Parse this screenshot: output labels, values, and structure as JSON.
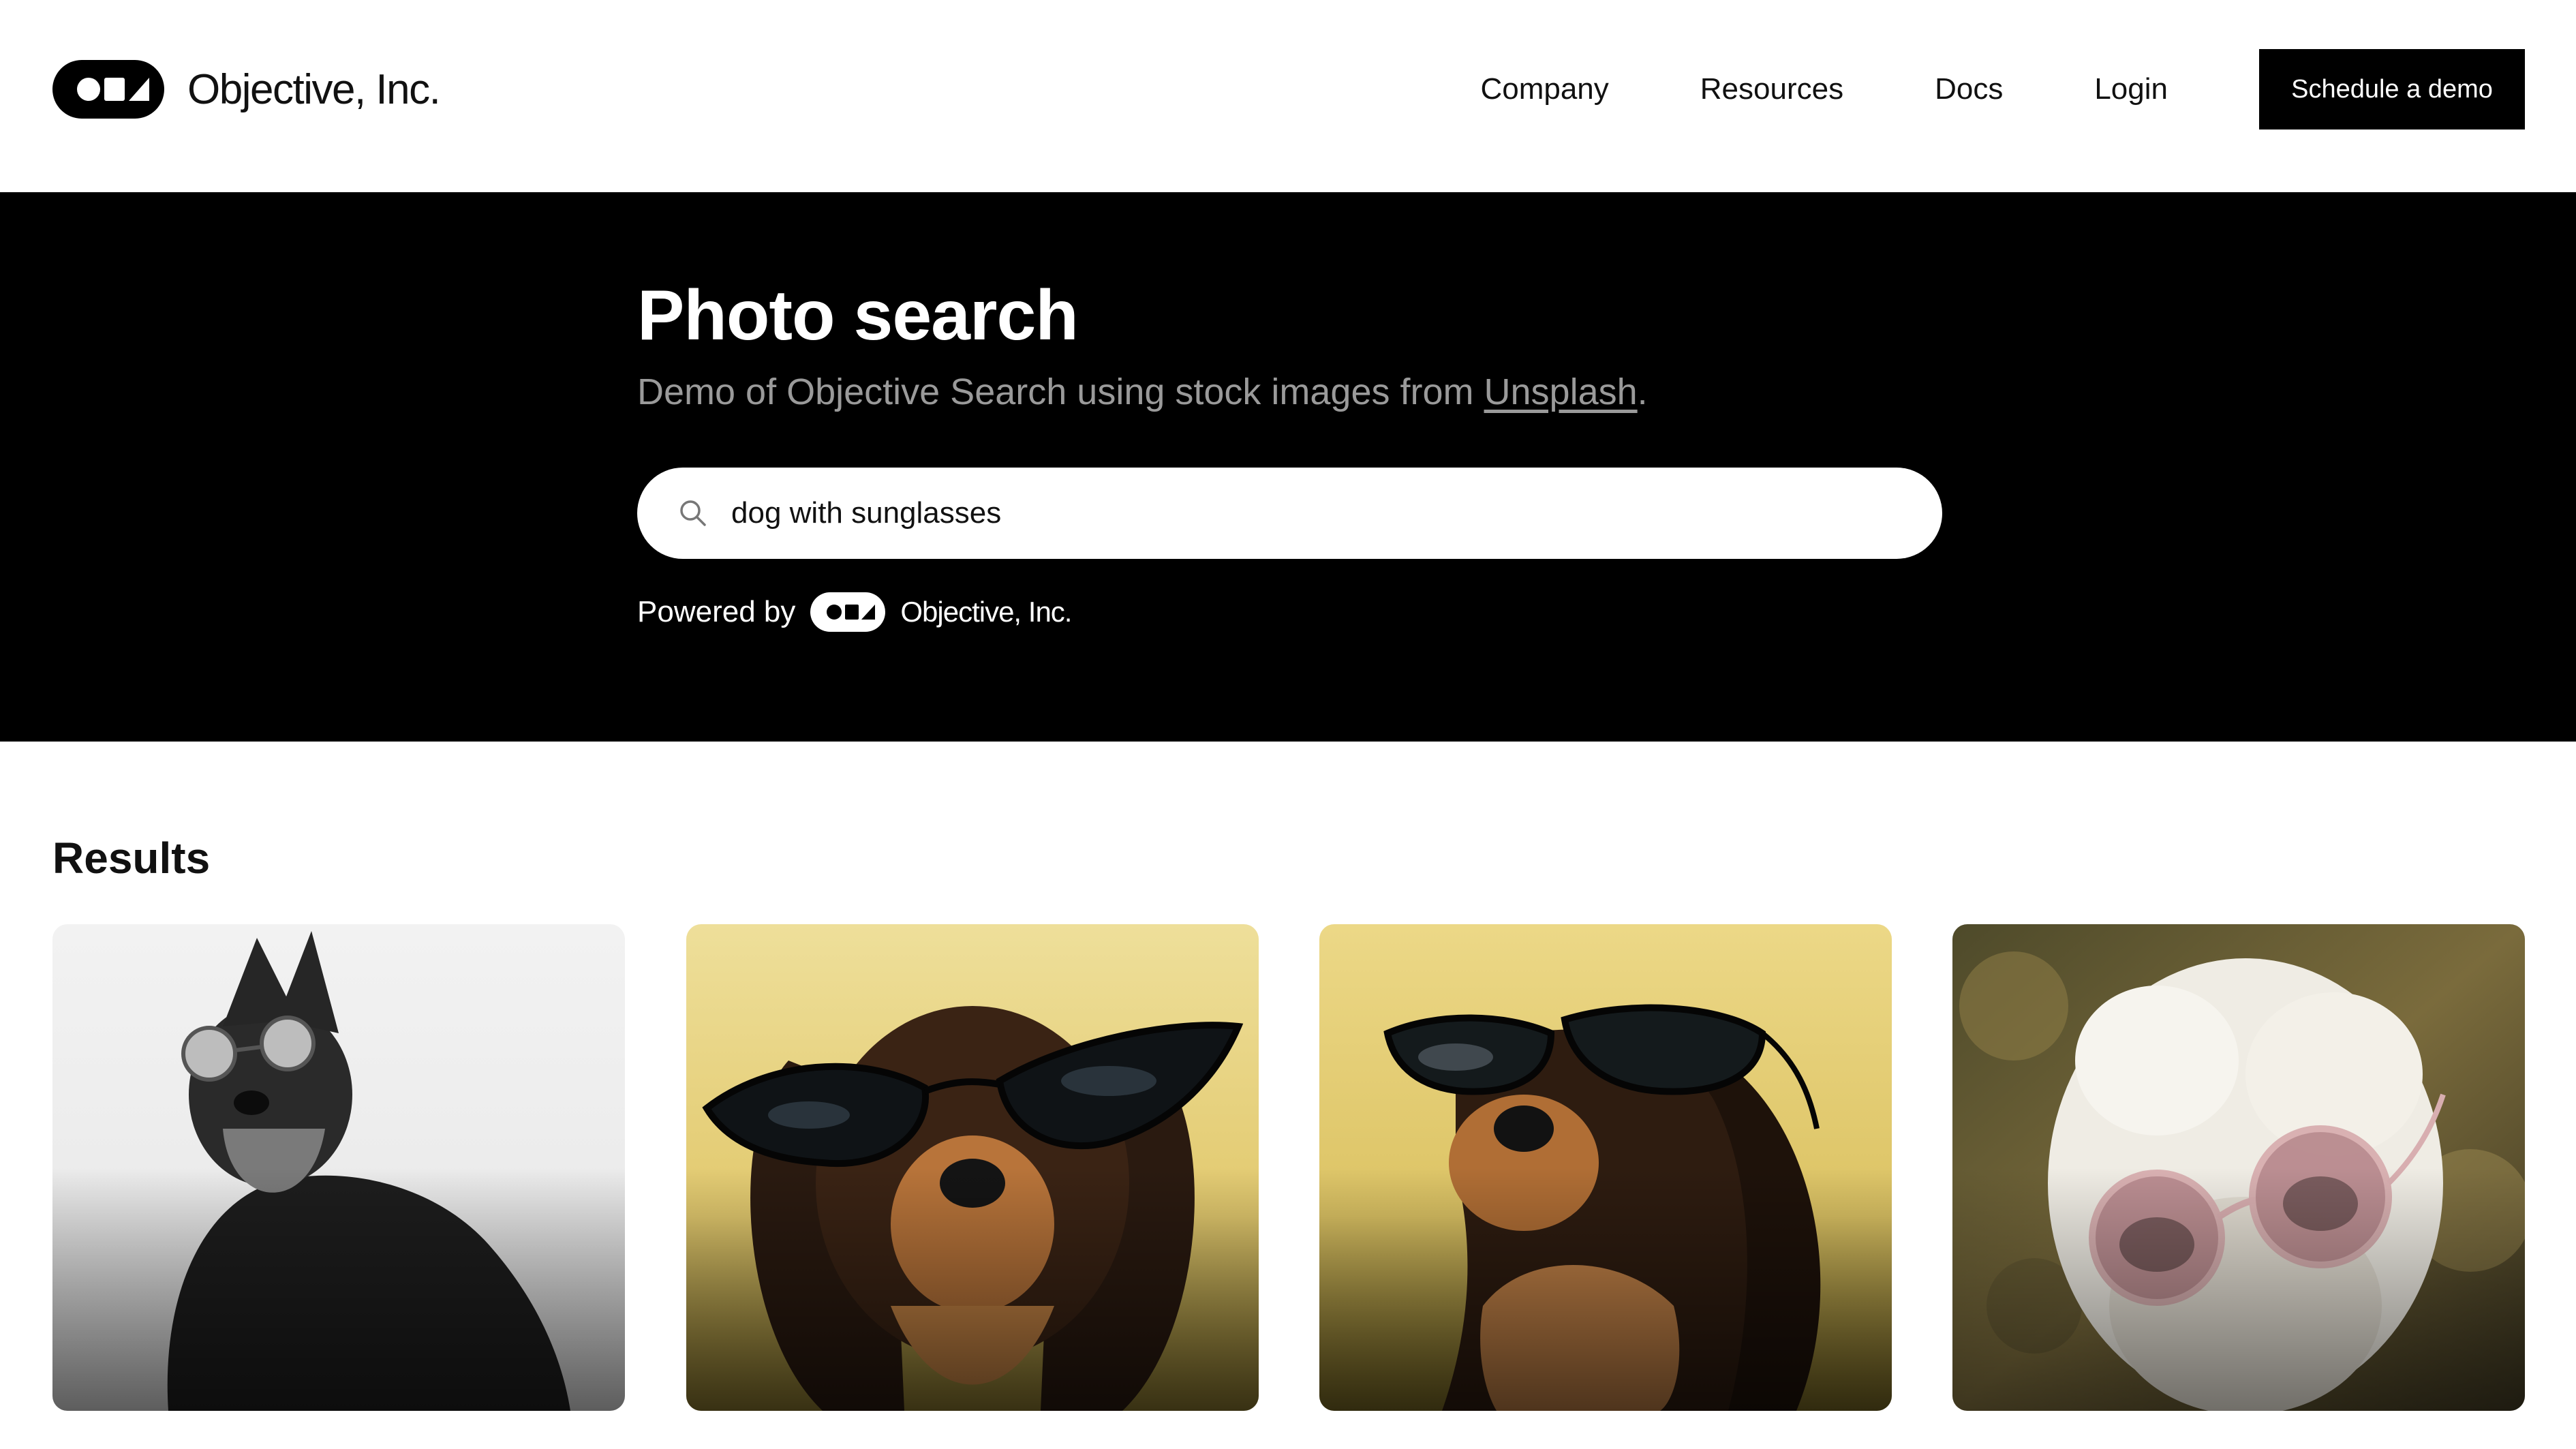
{
  "brand": {
    "name": "Objective, Inc."
  },
  "nav": {
    "links": [
      "Company",
      "Resources",
      "Docs",
      "Login"
    ],
    "cta": "Schedule a demo"
  },
  "hero": {
    "title": "Photo search",
    "subtitle_prefix": "Demo of Objective Search using stock images from ",
    "subtitle_link": "Unsplash",
    "subtitle_suffix": ".",
    "search": {
      "icon": "search-icon",
      "value": "dog with sunglasses"
    },
    "powered_by_label": "Powered by",
    "powered_by_name": "Objective, Inc."
  },
  "results": {
    "title": "Results",
    "items": [
      {
        "subject": "schnauzer with round sunglasses"
      },
      {
        "subject": "dachshund with cat-eye sunglasses"
      },
      {
        "subject": "dachshund with cat-eye sunglasses, side view"
      },
      {
        "subject": "white doodle with pink round sunglasses"
      }
    ]
  },
  "colors": {
    "hero_bg": "#000000",
    "subtitle": "#9a9a9a",
    "cta_bg": "#000000"
  }
}
